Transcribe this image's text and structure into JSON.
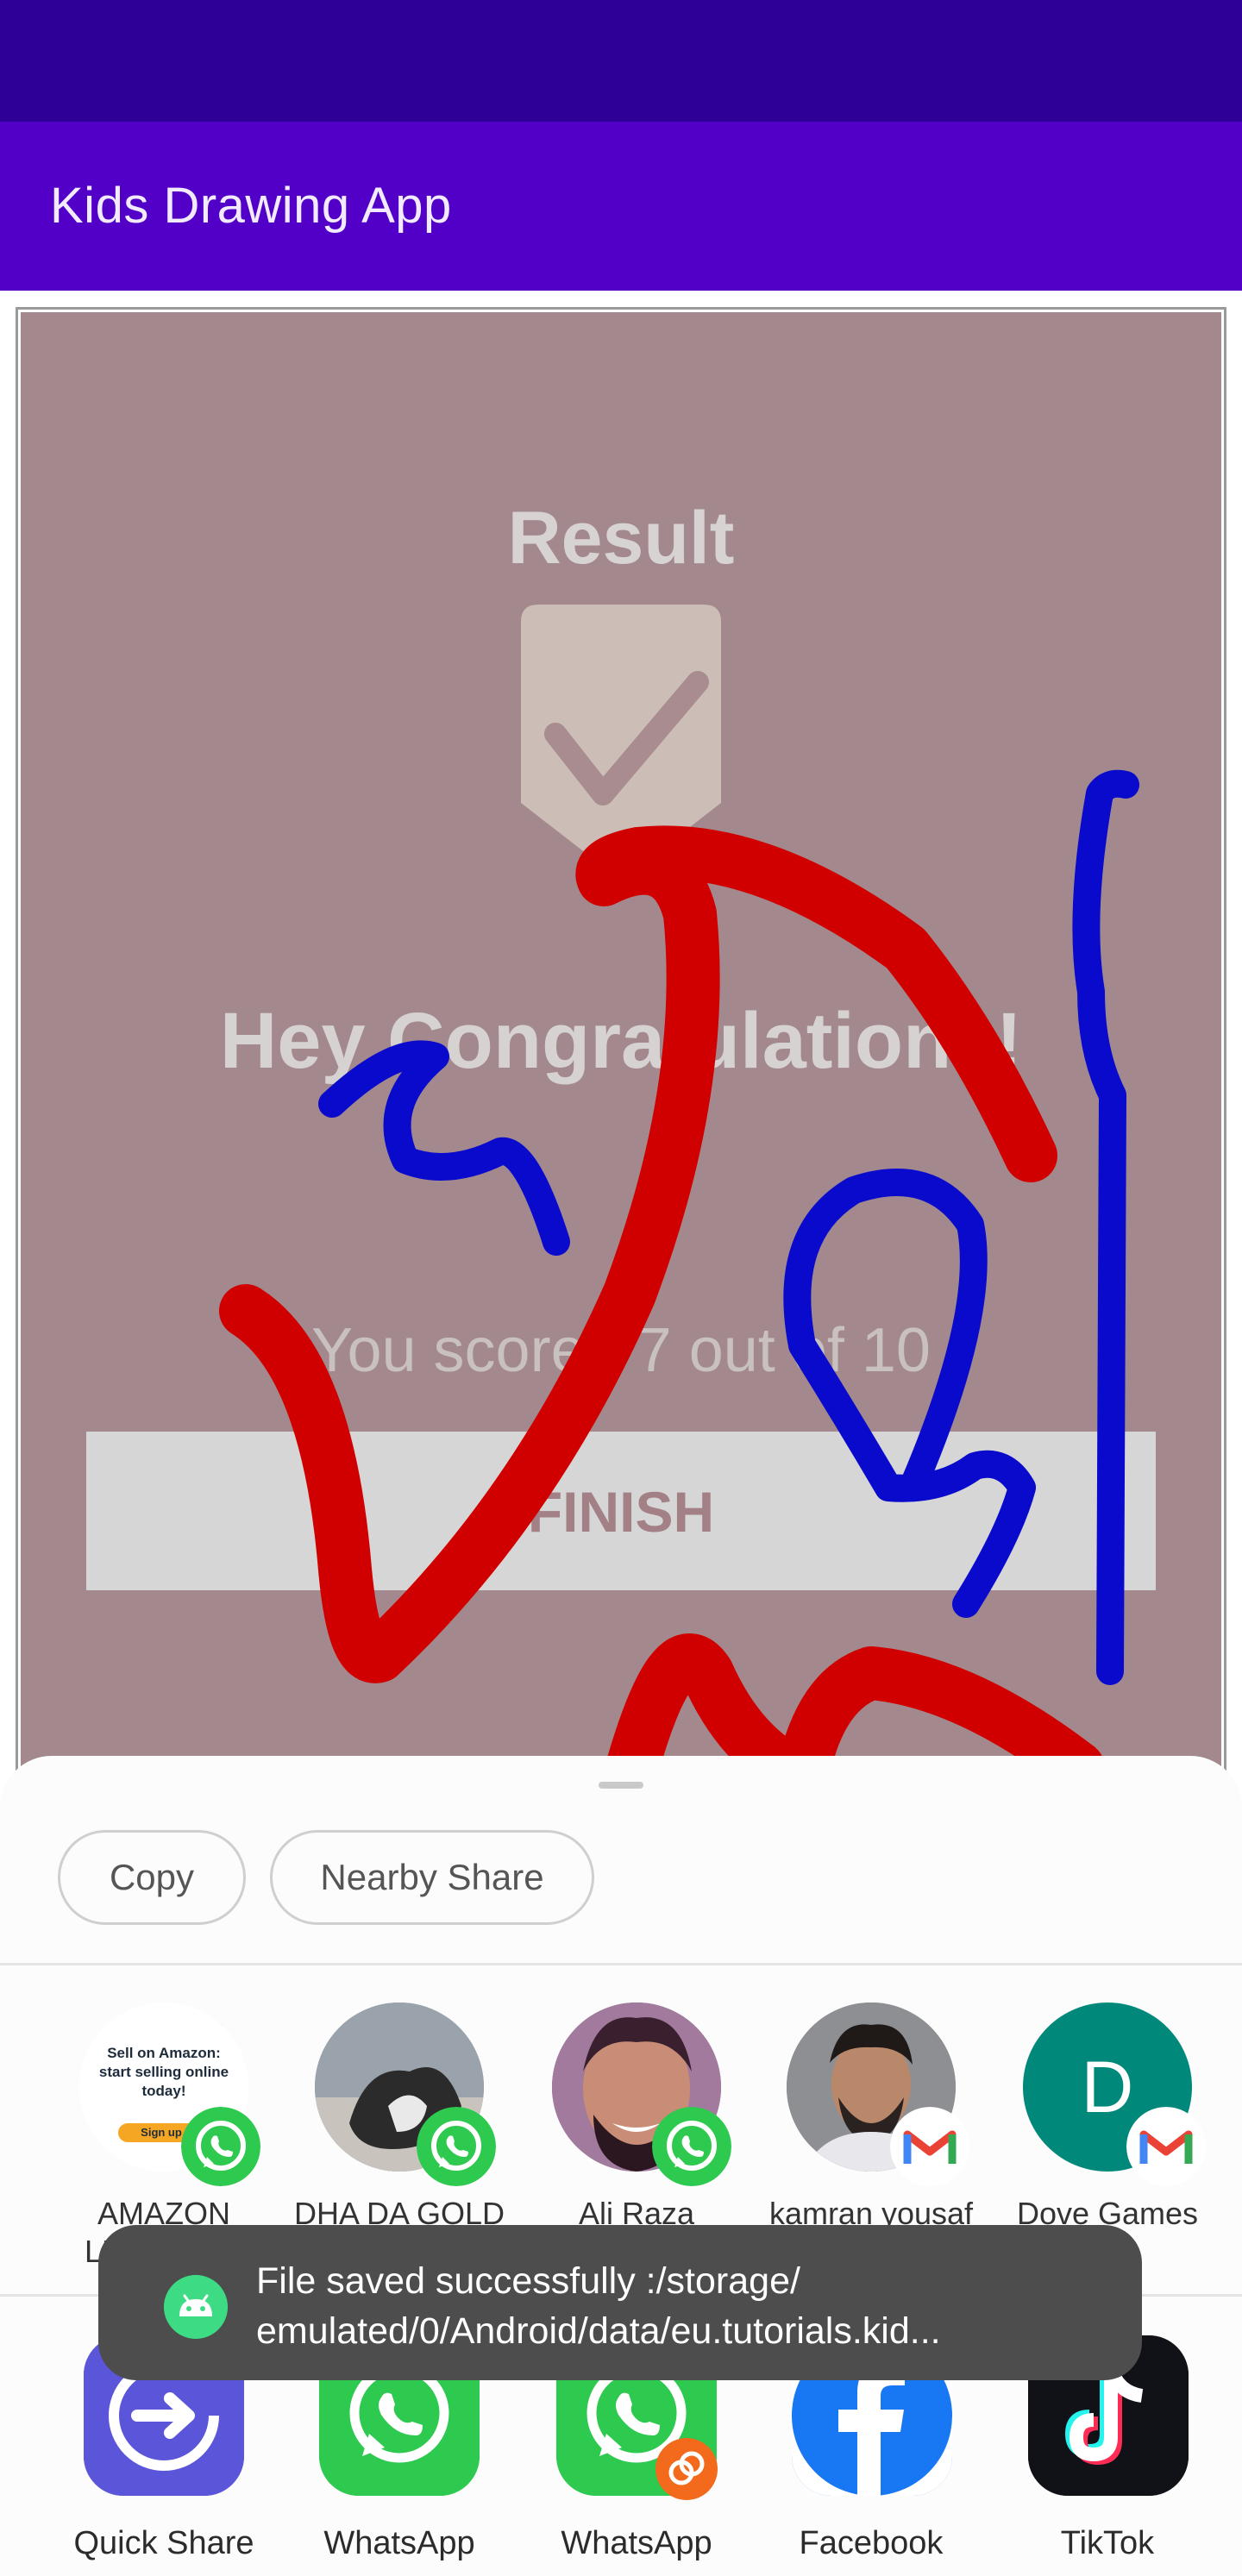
{
  "app": {
    "title": "Kids Drawing App"
  },
  "canvas": {
    "background_image": {
      "result_title": "Result",
      "congrats": "Hey Congratulations!",
      "score": "You scored 7 out of 10",
      "finish_button": "FINISH"
    },
    "brush_colors": {
      "red": "#D10000",
      "blue": "#0A0ACC"
    }
  },
  "share_sheet": {
    "chips": [
      {
        "label": "Copy"
      },
      {
        "label": "Nearby Share"
      }
    ],
    "contacts": [
      {
        "name": "AMAZON LEARNING CE...",
        "badge": "whatsapp-icon"
      },
      {
        "name": "DHA DA GOLD DIGGER",
        "badge": "whatsapp-icon"
      },
      {
        "name": "Ali Raza",
        "badge": "whatsapp-icon"
      },
      {
        "name": "kamran yousaf",
        "badge": "gmail-icon"
      },
      {
        "name": "Dove Games",
        "badge": "gmail-icon",
        "initial": "D"
      }
    ],
    "contact_image_text": {
      "amazon_ad_line1": "Sell on Amazon:",
      "amazon_ad_line2": "start selling online",
      "amazon_ad_line3": "today!",
      "amazon_ad_button": "Sign up"
    },
    "apps": [
      {
        "name": "Quick Share",
        "icon": "quick-share-icon"
      },
      {
        "name": "WhatsApp",
        "icon": "whatsapp-icon"
      },
      {
        "name": "WhatsApp",
        "icon": "whatsapp-business-icon"
      },
      {
        "name": "Facebook",
        "icon": "facebook-icon"
      },
      {
        "name": "TikTok",
        "icon": "tiktok-icon"
      }
    ]
  },
  "toast": {
    "line1": "File saved successfully :/storage/",
    "line2": "emulated/0/Android/data/eu.tutorials.kid..."
  }
}
